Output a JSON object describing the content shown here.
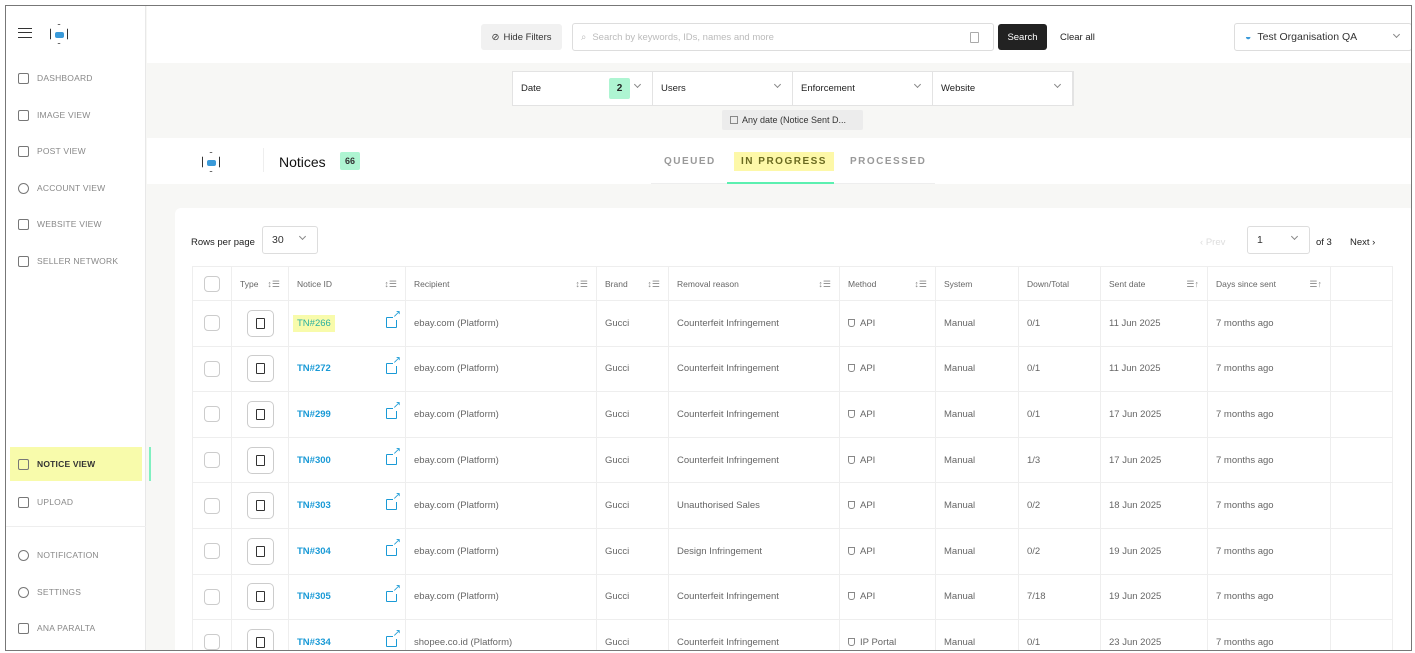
{
  "sidebar": {
    "items": [
      {
        "label": "DASHBOARD",
        "icon": "grid-icon"
      },
      {
        "label": "IMAGE VIEW",
        "icon": "image-icon"
      },
      {
        "label": "POST VIEW",
        "icon": "document-icon"
      },
      {
        "label": "ACCOUNT VIEW",
        "icon": "user-circle-icon"
      },
      {
        "label": "WEBSITE VIEW",
        "icon": "browser-icon"
      },
      {
        "label": "SELLER NETWORK",
        "icon": "network-icon"
      },
      {
        "label": "NOTICE VIEW",
        "icon": "notice-icon",
        "active": true
      },
      {
        "label": "UPLOAD",
        "icon": "upload-icon"
      },
      {
        "label": "NOTIFICATION",
        "icon": "bell-icon"
      },
      {
        "label": "SETTINGS",
        "icon": "gear-icon"
      },
      {
        "label": "ANA PARALTA",
        "icon": "avatar"
      }
    ]
  },
  "topbar": {
    "hide_filters": "Hide Filters",
    "search_placeholder": "Search by keywords, IDs, names and more",
    "search": "Search",
    "clear_all": "Clear all",
    "organisation": "Test Organisation QA"
  },
  "filters": {
    "items": [
      {
        "label": "Date",
        "count": "2"
      },
      {
        "label": "Users"
      },
      {
        "label": "Enforcement"
      },
      {
        "label": "Website"
      }
    ],
    "chip": "Any date (Notice Sent D..."
  },
  "notices": {
    "title": "Notices",
    "count": "66",
    "tabs": [
      "QUEUED",
      "IN PROGRESS",
      "PROCESSED"
    ],
    "active_tab": "IN PROGRESS"
  },
  "pagination": {
    "rows_label": "Rows per page",
    "rows": "30",
    "prev": "Prev",
    "page": "1",
    "of": "of 3",
    "next": "Next"
  },
  "table": {
    "headers": [
      "Type",
      "Notice ID",
      "Recipient",
      "Brand",
      "Removal reason",
      "Method",
      "System",
      "Down/Total",
      "Sent date",
      "Days since sent"
    ],
    "rows": [
      {
        "id": "TN#266",
        "recipient": "ebay.com (Platform)",
        "brand": "Gucci",
        "reason": "Counterfeit Infringement",
        "method": "API",
        "system": "Manual",
        "down": "0/1",
        "sent": "11 Jun 2025",
        "days": "7 months ago"
      },
      {
        "id": "TN#272",
        "recipient": "ebay.com (Platform)",
        "brand": "Gucci",
        "reason": "Counterfeit Infringement",
        "method": "API",
        "system": "Manual",
        "down": "0/1",
        "sent": "11 Jun 2025",
        "days": "7 months ago"
      },
      {
        "id": "TN#299",
        "recipient": "ebay.com (Platform)",
        "brand": "Gucci",
        "reason": "Counterfeit Infringement",
        "method": "API",
        "system": "Manual",
        "down": "0/1",
        "sent": "17 Jun 2025",
        "days": "7 months ago"
      },
      {
        "id": "TN#300",
        "recipient": "ebay.com (Platform)",
        "brand": "Gucci",
        "reason": "Counterfeit Infringement",
        "method": "API",
        "system": "Manual",
        "down": "1/3",
        "sent": "17 Jun 2025",
        "days": "7 months ago"
      },
      {
        "id": "TN#303",
        "recipient": "ebay.com (Platform)",
        "brand": "Gucci",
        "reason": "Unauthorised Sales",
        "method": "API",
        "system": "Manual",
        "down": "0/2",
        "sent": "18 Jun 2025",
        "days": "7 months ago"
      },
      {
        "id": "TN#304",
        "recipient": "ebay.com (Platform)",
        "brand": "Gucci",
        "reason": "Design Infringement",
        "method": "API",
        "system": "Manual",
        "down": "0/2",
        "sent": "19 Jun 2025",
        "days": "7 months ago"
      },
      {
        "id": "TN#305",
        "recipient": "ebay.com (Platform)",
        "brand": "Gucci",
        "reason": "Counterfeit Infringement",
        "method": "API",
        "system": "Manual",
        "down": "7/18",
        "sent": "19 Jun 2025",
        "days": "7 months ago"
      },
      {
        "id": "TN#334",
        "recipient": "shopee.co.id (Platform)",
        "brand": "Gucci",
        "reason": "Counterfeit Infringement",
        "method": "IP Portal",
        "system": "Manual",
        "down": "0/1",
        "sent": "23 Jun 2025",
        "days": "7 months ago"
      }
    ]
  },
  "colors": {
    "accent_green": "#aef5d2",
    "highlight_yellow": "#f8fbab",
    "link_blue": "#1a9ad6"
  }
}
